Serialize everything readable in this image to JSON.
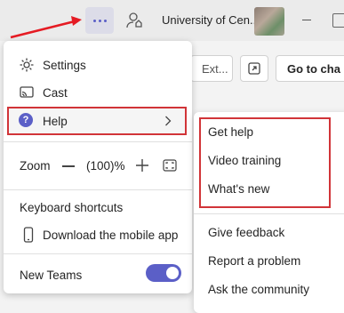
{
  "titlebar": {
    "org_name": "University of Cen..."
  },
  "background": {
    "ext_label": "Ext...",
    "goto_label": "Go to cha"
  },
  "menu": {
    "settings": "Settings",
    "cast": "Cast",
    "help": "Help",
    "zoom_label": "Zoom",
    "zoom_value": "(100)%",
    "keyboard_shortcuts": "Keyboard shortcuts",
    "download_mobile": "Download the mobile app",
    "new_teams": "New Teams",
    "new_teams_enabled": true
  },
  "help_submenu": {
    "items": [
      "Get help",
      "Video training",
      "What's new",
      "Give feedback",
      "Report a problem",
      "Ask the community"
    ]
  },
  "colors": {
    "accent": "#5b5fc7",
    "highlight_border": "#d13438",
    "arrow": "#e51b23"
  }
}
